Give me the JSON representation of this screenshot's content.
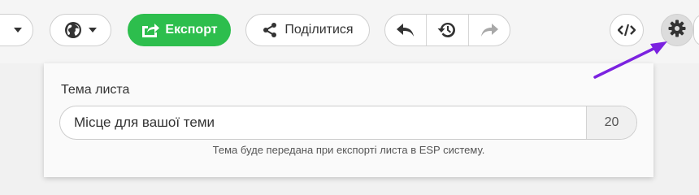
{
  "toolbar": {
    "export_label": "Експорт",
    "share_label": "Поділитися",
    "icons": {
      "dropdown": "chevron-down-icon",
      "language": "globe-icon",
      "export": "export-icon",
      "share": "share-icon",
      "undo": "undo-icon",
      "history": "history-icon",
      "redo": "redo-icon",
      "code": "code-icon",
      "settings": "gear-icon"
    },
    "colors": {
      "export_bg": "#2dbe4d",
      "annotation_arrow": "#7b22e0"
    }
  },
  "panel": {
    "subject_label": "Тема листа",
    "subject_placeholder": "Місце для вашої теми",
    "char_count": "20",
    "hint": "Тема буде передана при експорті листа в ESP систему."
  }
}
